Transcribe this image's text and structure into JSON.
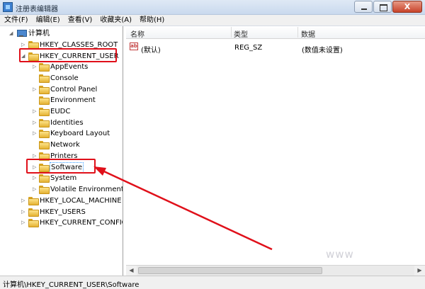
{
  "window": {
    "title": "注册表编辑器",
    "controls": {
      "close": "X"
    }
  },
  "menu": [
    "文件(F)",
    "编辑(E)",
    "查看(V)",
    "收藏夹(A)",
    "帮助(H)"
  ],
  "tree": {
    "root": "计算机",
    "hkcr": "HKEY_CLASSES_ROOT",
    "hkcu": "HKEY_CURRENT_USER",
    "hkcu_children": [
      "AppEvents",
      "Console",
      "Control Panel",
      "Environment",
      "EUDC",
      "Identities",
      "Keyboard Layout",
      "Network",
      "Printers",
      "Software",
      "System",
      "Volatile Environment"
    ],
    "hklm": "HKEY_LOCAL_MACHINE",
    "hku": "HKEY_USERS",
    "hkcc": "HKEY_CURRENT_CONFIG",
    "selected": "Software"
  },
  "list": {
    "columns": [
      "名称",
      "类型",
      "数据"
    ],
    "rows": [
      {
        "name": "(默认)",
        "type": "REG_SZ",
        "data": "(数值未设置)",
        "icon": "ab-string-icon"
      }
    ]
  },
  "status_bar": "计算机\\HKEY_CURRENT_USER\\Software",
  "watermark": "www"
}
